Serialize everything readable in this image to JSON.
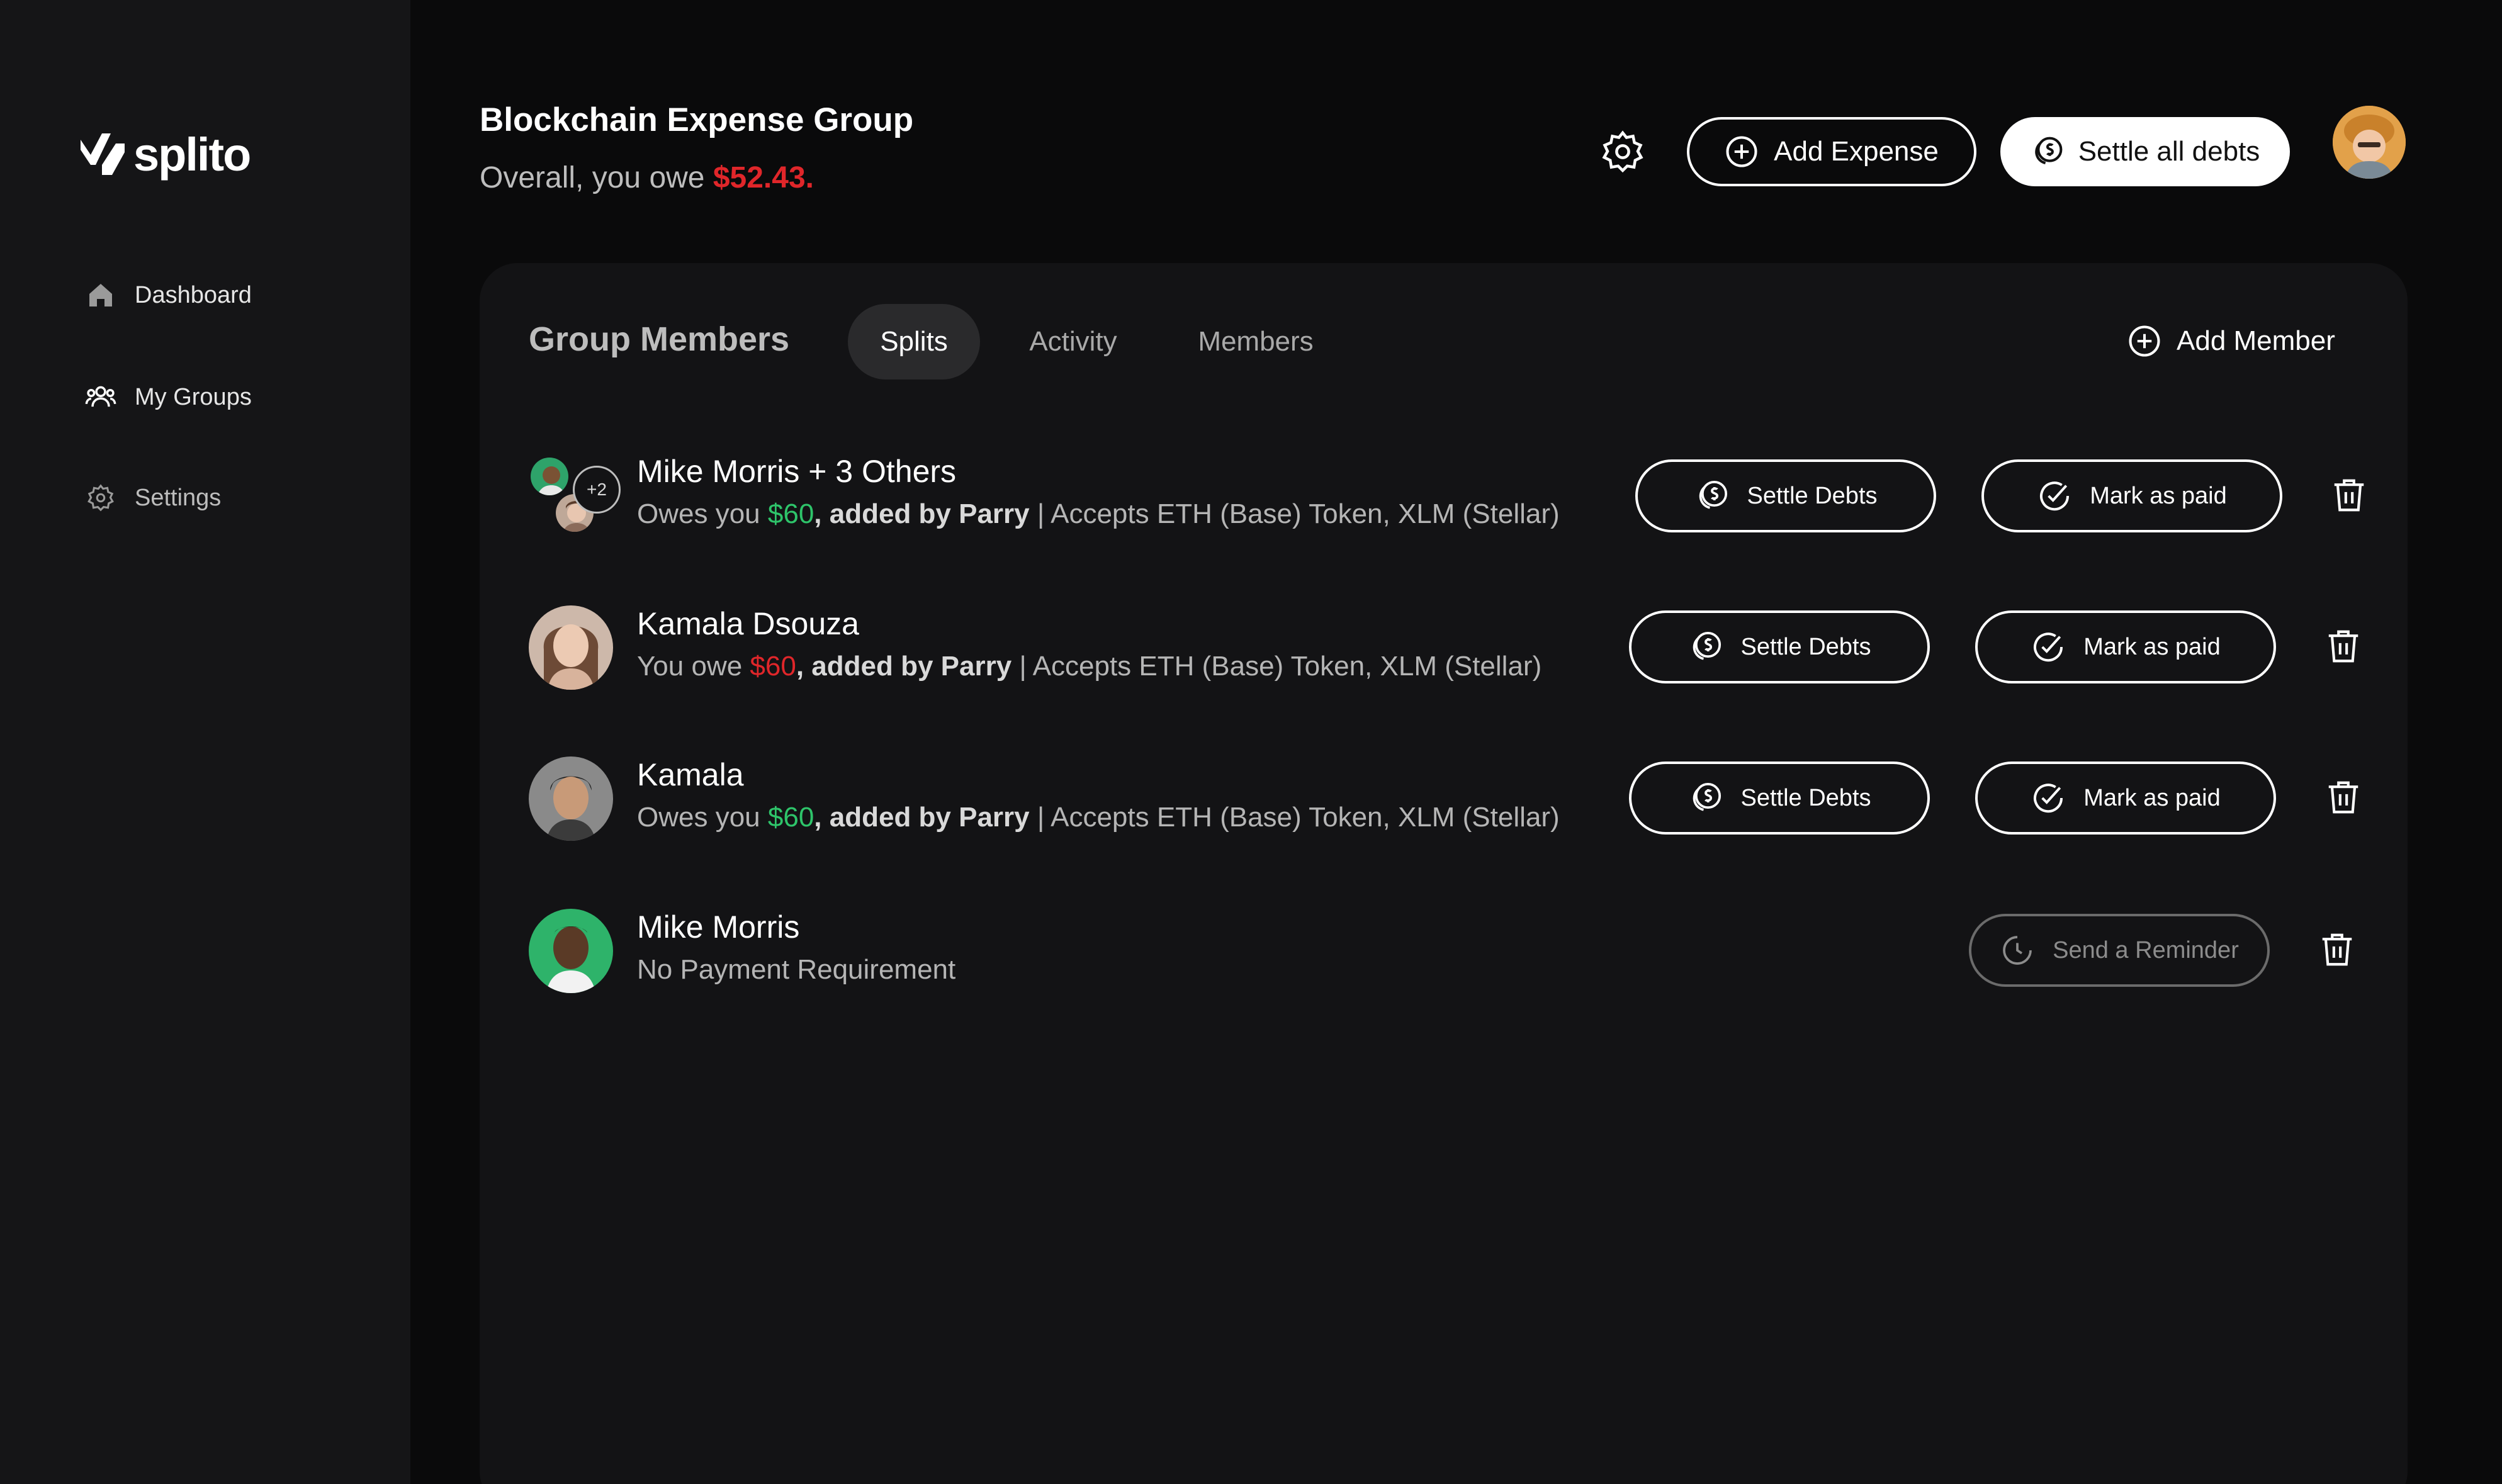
{
  "app": {
    "logo_text": "splito"
  },
  "sidebar": {
    "items": [
      {
        "label": "Dashboard",
        "icon": "home-icon"
      },
      {
        "label": "My Groups",
        "icon": "users-icon"
      },
      {
        "label": "Settings",
        "icon": "gear-icon"
      }
    ]
  },
  "header": {
    "title": "Blockchain Expense Group",
    "overall_prefix": "Overall, you owe ",
    "overall_amount": "$52.43.",
    "add_expense_label": "Add Expense",
    "settle_all_label": "Settle all debts"
  },
  "panel": {
    "title": "Group Members",
    "tabs": [
      {
        "label": "Splits",
        "active": true
      },
      {
        "label": "Activity",
        "active": false
      },
      {
        "label": "Members",
        "active": false
      }
    ],
    "add_member_label": "Add Member"
  },
  "rows": [
    {
      "name": "Mike Morris + 3 Others",
      "prefix": "Owes you ",
      "amount": "$60",
      "amount_color": "green",
      "by": ", added by Parry",
      "accepts": " | Accepts ETH (Base) Token, XLM (Stellar)",
      "extra_count": "+2",
      "settle_label": "Settle Debts",
      "paid_label": "Mark as paid"
    },
    {
      "name": "Kamala Dsouza",
      "prefix": "You owe ",
      "amount": "$60",
      "amount_color": "red",
      "by": ", added by Parry",
      "accepts": " | Accepts ETH (Base) Token, XLM (Stellar)",
      "settle_label": "Settle Debts",
      "paid_label": "Mark as paid"
    },
    {
      "name": "Kamala",
      "prefix": "Owes you ",
      "amount": "$60",
      "amount_color": "green",
      "by": ", added by Parry",
      "accepts": " | Accepts ETH (Base) Token, XLM (Stellar)",
      "settle_label": "Settle Debts",
      "paid_label": "Mark as paid"
    },
    {
      "name": "Mike Morris",
      "sub": "No Payment Requirement",
      "reminder_label": "Send a Reminder"
    }
  ],
  "colors": {
    "positive": "#2ec46a",
    "negative": "#e0262a",
    "sidebar_bg": "#151517",
    "panel_bg": "#131315"
  }
}
